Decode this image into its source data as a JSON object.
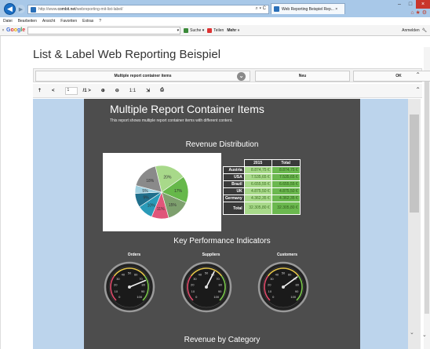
{
  "browser": {
    "url_prefix": "http://www.",
    "url_domain": "combit.net",
    "url_path": "/webreporting-mit-list-label/",
    "address_tools": "⌕ ▾ C",
    "tab_title": "Web Reporting Beispiel Rep... ×",
    "menu": [
      "Datei",
      "Bearbeiten",
      "Ansicht",
      "Favoriten",
      "Extras",
      "?"
    ],
    "google": {
      "logo": "Google",
      "search_label": "Suche ▾",
      "share_label": "Teilen",
      "more_label": "Mehr »",
      "signin_label": "Anmelden",
      "close_glyph": "×"
    },
    "window_controls": {
      "min": "–",
      "max": "□",
      "close": "×"
    },
    "toolbar_icons": "⌂ ★ ⚙"
  },
  "page": {
    "title": "List & Label Web Reporting Beispiel",
    "report_select": "Multiple report container items",
    "new_button": "Neu",
    "ok_button": "OK",
    "page_current": "1",
    "page_total": "/1 >",
    "zoom_reset": "1:1"
  },
  "report": {
    "title": "Multiple Report Container Items",
    "subtitle": "This report shows multiple report container items with different content.",
    "section_revenue": "Revenue Distribution",
    "section_kpi": "Key Performance Indicators",
    "section_category": "Revenue by Category",
    "table_header": [
      "",
      "2015",
      "Total"
    ],
    "table_rows": [
      {
        "country": "Austria",
        "v2015": "8.874,75 €",
        "total": "8.874,75 €"
      },
      {
        "country": "USA",
        "v2015": "7.535,65 €",
        "total": "7.535,65 €"
      },
      {
        "country": "Brazil",
        "v2015": "6.655,55 €",
        "total": "6.655,55 €"
      },
      {
        "country": "UK",
        "v2015": "4.875,50 €",
        "total": "4.875,50 €"
      },
      {
        "country": "Germany",
        "v2015": "4.362,35 €",
        "total": "4.362,35 €"
      },
      {
        "country": "Total",
        "v2015": "32.305,80 €",
        "total": "32.305,80 €"
      }
    ],
    "gauges": [
      {
        "label": "Orders",
        "value": 75
      },
      {
        "label": "Suppliers",
        "value": 60
      },
      {
        "label": "Customers",
        "value": 70
      }
    ],
    "gauge_ticks": [
      "0",
      "10",
      "20",
      "30",
      "40",
      "50",
      "60",
      "70",
      "80",
      "90",
      "100"
    ]
  },
  "chart_data": {
    "type": "pie",
    "categories": [
      "",
      "",
      "",
      "",
      "",
      "",
      "",
      ""
    ],
    "values": [
      20,
      17,
      15,
      11,
      10,
      9,
      5,
      18
    ],
    "slice_labels": [
      "20%",
      "17%",
      "15%",
      "11%",
      "10%",
      "9%",
      "5%",
      "18%"
    ],
    "colors": [
      "#a8d98a",
      "#66b84a",
      "#7ea06e",
      "#e0567a",
      "#2a9ab8",
      "#1f6f8c",
      "#9fd0e0",
      "#8a8a8a"
    ]
  }
}
